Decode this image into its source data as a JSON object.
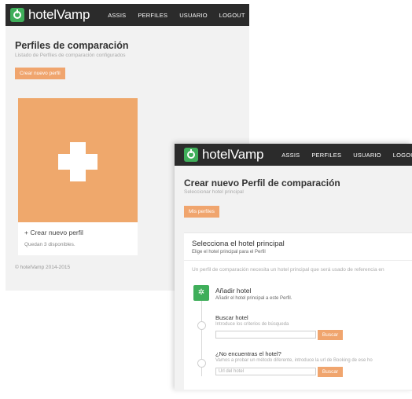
{
  "app": {
    "brand": "hotelVamp",
    "nav": [
      "ASSIS",
      "PERFILES",
      "USUARIO",
      "LOGOUT"
    ]
  },
  "back_window": {
    "title": "Perfiles de comparación",
    "subtitle": "Listado de Perfiles de comparación configurados",
    "create_button": "Crear nuevo perfil",
    "card": {
      "title": "+ Crear nuevo perfil",
      "subtitle": "Quedan 3 disponibles."
    },
    "footer": "© hotelVamp 2014-2015"
  },
  "front_window": {
    "title": "Crear nuevo Perfil de comparación",
    "subtitle": "Seleccionar hotel principal",
    "back_button": "Mis perfiles",
    "panel": {
      "title": "Selecciona el hotel principal",
      "subtitle": "Elige el hotel principal para el Perfil",
      "description": "Un perfil de comparación necesita un hotel principal que será usado de referencia en",
      "steps": [
        {
          "title": "Añadir hotel",
          "subtitle": "Añadir el hotel principal a este Perfil."
        },
        {
          "title": "Buscar hotel",
          "subtitle": "Introduce los criterios de búsqueda",
          "input_placeholder": "",
          "button": "Buscar"
        },
        {
          "title": "¿No encuentras el hotel?",
          "subtitle": "Vamos a probar un método diferente, introduce la url de Booking de ese ho",
          "input_placeholder": "Url del hotel",
          "button": "Buscar"
        }
      ]
    }
  },
  "colors": {
    "nav_bg": "#2b2b2b",
    "brand_green": "#3fae5a",
    "accent_orange": "#f0a56e",
    "page_bg": "#f2f2f2"
  },
  "icons": {
    "logo": "power-icon",
    "add": "plus-icon",
    "active_step": "gear-icon"
  }
}
